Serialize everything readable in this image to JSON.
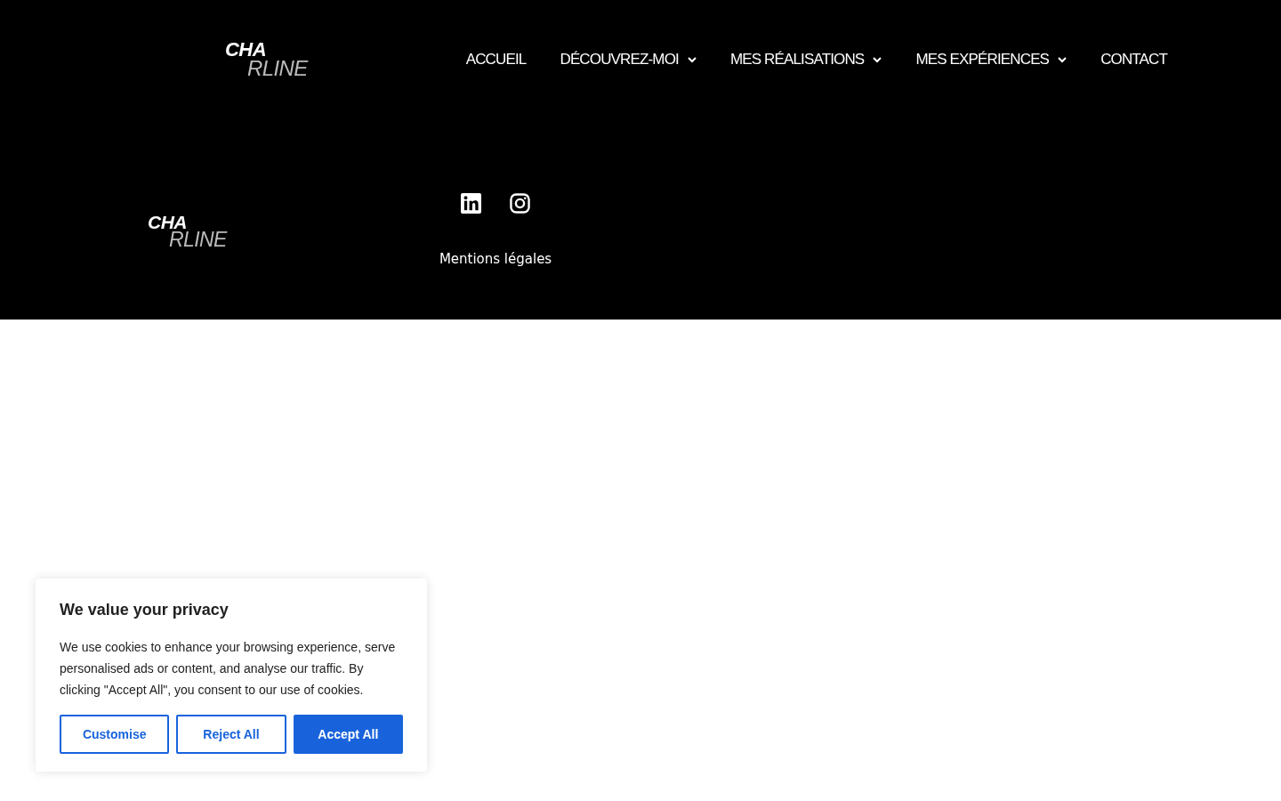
{
  "header": {
    "logo": {
      "top": "CHA",
      "bottom": "RLINE"
    },
    "nav": [
      {
        "label": "ACCUEIL",
        "dropdown": false
      },
      {
        "label": "DÉCOUVREZ-MOI",
        "dropdown": true
      },
      {
        "label": "MES RÉALISATIONS",
        "dropdown": true
      },
      {
        "label": "MES EXPÉRIENCES",
        "dropdown": true
      },
      {
        "label": "CONTACT",
        "dropdown": false
      }
    ]
  },
  "footer": {
    "logo": {
      "top": "CHA",
      "bottom": "RLINE"
    },
    "social": [
      {
        "kind": "linkedin"
      },
      {
        "kind": "instagram"
      }
    ],
    "link": "Mentions légales"
  },
  "cookie_banner": {
    "title": "We value your privacy",
    "text": "We use cookies to enhance your browsing experience, serve personalised ads or content, and analyse our traffic. By clicking \"Accept All\", you consent to our use of cookies.",
    "buttons": [
      {
        "label": "Customise",
        "kind": "outline"
      },
      {
        "label": "Reject All",
        "kind": "outline"
      },
      {
        "label": "Accept All",
        "kind": "filled"
      }
    ]
  }
}
